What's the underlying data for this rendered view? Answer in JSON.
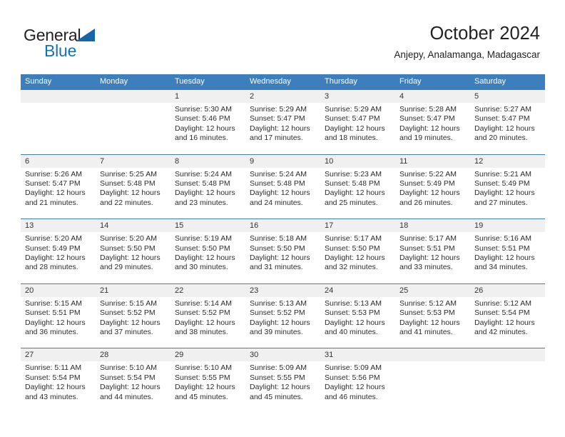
{
  "brand": {
    "name_part1": "General",
    "name_part2": "Blue",
    "triangle_icon": "triangle-icon",
    "color_dark": "#231f20",
    "color_blue": "#1570bc"
  },
  "header": {
    "title": "October 2024",
    "subtitle": "Anjepy, Analamanga, Madagascar"
  },
  "colors": {
    "header_blue": "#3d7ebd",
    "number_strip": "#f0f0f0",
    "text": "#2b2b2b"
  },
  "weekdays": [
    "Sunday",
    "Monday",
    "Tuesday",
    "Wednesday",
    "Thursday",
    "Friday",
    "Saturday"
  ],
  "weeks": [
    [
      {
        "day": "",
        "sunrise": "",
        "sunset": "",
        "daylight1": "",
        "daylight2": ""
      },
      {
        "day": "",
        "sunrise": "",
        "sunset": "",
        "daylight1": "",
        "daylight2": ""
      },
      {
        "day": "1",
        "sunrise": "Sunrise: 5:30 AM",
        "sunset": "Sunset: 5:46 PM",
        "daylight1": "Daylight: 12 hours",
        "daylight2": "and 16 minutes."
      },
      {
        "day": "2",
        "sunrise": "Sunrise: 5:29 AM",
        "sunset": "Sunset: 5:47 PM",
        "daylight1": "Daylight: 12 hours",
        "daylight2": "and 17 minutes."
      },
      {
        "day": "3",
        "sunrise": "Sunrise: 5:29 AM",
        "sunset": "Sunset: 5:47 PM",
        "daylight1": "Daylight: 12 hours",
        "daylight2": "and 18 minutes."
      },
      {
        "day": "4",
        "sunrise": "Sunrise: 5:28 AM",
        "sunset": "Sunset: 5:47 PM",
        "daylight1": "Daylight: 12 hours",
        "daylight2": "and 19 minutes."
      },
      {
        "day": "5",
        "sunrise": "Sunrise: 5:27 AM",
        "sunset": "Sunset: 5:47 PM",
        "daylight1": "Daylight: 12 hours",
        "daylight2": "and 20 minutes."
      }
    ],
    [
      {
        "day": "6",
        "sunrise": "Sunrise: 5:26 AM",
        "sunset": "Sunset: 5:47 PM",
        "daylight1": "Daylight: 12 hours",
        "daylight2": "and 21 minutes."
      },
      {
        "day": "7",
        "sunrise": "Sunrise: 5:25 AM",
        "sunset": "Sunset: 5:48 PM",
        "daylight1": "Daylight: 12 hours",
        "daylight2": "and 22 minutes."
      },
      {
        "day": "8",
        "sunrise": "Sunrise: 5:24 AM",
        "sunset": "Sunset: 5:48 PM",
        "daylight1": "Daylight: 12 hours",
        "daylight2": "and 23 minutes."
      },
      {
        "day": "9",
        "sunrise": "Sunrise: 5:24 AM",
        "sunset": "Sunset: 5:48 PM",
        "daylight1": "Daylight: 12 hours",
        "daylight2": "and 24 minutes."
      },
      {
        "day": "10",
        "sunrise": "Sunrise: 5:23 AM",
        "sunset": "Sunset: 5:48 PM",
        "daylight1": "Daylight: 12 hours",
        "daylight2": "and 25 minutes."
      },
      {
        "day": "11",
        "sunrise": "Sunrise: 5:22 AM",
        "sunset": "Sunset: 5:49 PM",
        "daylight1": "Daylight: 12 hours",
        "daylight2": "and 26 minutes."
      },
      {
        "day": "12",
        "sunrise": "Sunrise: 5:21 AM",
        "sunset": "Sunset: 5:49 PM",
        "daylight1": "Daylight: 12 hours",
        "daylight2": "and 27 minutes."
      }
    ],
    [
      {
        "day": "13",
        "sunrise": "Sunrise: 5:20 AM",
        "sunset": "Sunset: 5:49 PM",
        "daylight1": "Daylight: 12 hours",
        "daylight2": "and 28 minutes."
      },
      {
        "day": "14",
        "sunrise": "Sunrise: 5:20 AM",
        "sunset": "Sunset: 5:50 PM",
        "daylight1": "Daylight: 12 hours",
        "daylight2": "and 29 minutes."
      },
      {
        "day": "15",
        "sunrise": "Sunrise: 5:19 AM",
        "sunset": "Sunset: 5:50 PM",
        "daylight1": "Daylight: 12 hours",
        "daylight2": "and 30 minutes."
      },
      {
        "day": "16",
        "sunrise": "Sunrise: 5:18 AM",
        "sunset": "Sunset: 5:50 PM",
        "daylight1": "Daylight: 12 hours",
        "daylight2": "and 31 minutes."
      },
      {
        "day": "17",
        "sunrise": "Sunrise: 5:17 AM",
        "sunset": "Sunset: 5:50 PM",
        "daylight1": "Daylight: 12 hours",
        "daylight2": "and 32 minutes."
      },
      {
        "day": "18",
        "sunrise": "Sunrise: 5:17 AM",
        "sunset": "Sunset: 5:51 PM",
        "daylight1": "Daylight: 12 hours",
        "daylight2": "and 33 minutes."
      },
      {
        "day": "19",
        "sunrise": "Sunrise: 5:16 AM",
        "sunset": "Sunset: 5:51 PM",
        "daylight1": "Daylight: 12 hours",
        "daylight2": "and 34 minutes."
      }
    ],
    [
      {
        "day": "20",
        "sunrise": "Sunrise: 5:15 AM",
        "sunset": "Sunset: 5:51 PM",
        "daylight1": "Daylight: 12 hours",
        "daylight2": "and 36 minutes."
      },
      {
        "day": "21",
        "sunrise": "Sunrise: 5:15 AM",
        "sunset": "Sunset: 5:52 PM",
        "daylight1": "Daylight: 12 hours",
        "daylight2": "and 37 minutes."
      },
      {
        "day": "22",
        "sunrise": "Sunrise: 5:14 AM",
        "sunset": "Sunset: 5:52 PM",
        "daylight1": "Daylight: 12 hours",
        "daylight2": "and 38 minutes."
      },
      {
        "day": "23",
        "sunrise": "Sunrise: 5:13 AM",
        "sunset": "Sunset: 5:52 PM",
        "daylight1": "Daylight: 12 hours",
        "daylight2": "and 39 minutes."
      },
      {
        "day": "24",
        "sunrise": "Sunrise: 5:13 AM",
        "sunset": "Sunset: 5:53 PM",
        "daylight1": "Daylight: 12 hours",
        "daylight2": "and 40 minutes."
      },
      {
        "day": "25",
        "sunrise": "Sunrise: 5:12 AM",
        "sunset": "Sunset: 5:53 PM",
        "daylight1": "Daylight: 12 hours",
        "daylight2": "and 41 minutes."
      },
      {
        "day": "26",
        "sunrise": "Sunrise: 5:12 AM",
        "sunset": "Sunset: 5:54 PM",
        "daylight1": "Daylight: 12 hours",
        "daylight2": "and 42 minutes."
      }
    ],
    [
      {
        "day": "27",
        "sunrise": "Sunrise: 5:11 AM",
        "sunset": "Sunset: 5:54 PM",
        "daylight1": "Daylight: 12 hours",
        "daylight2": "and 43 minutes."
      },
      {
        "day": "28",
        "sunrise": "Sunrise: 5:10 AM",
        "sunset": "Sunset: 5:54 PM",
        "daylight1": "Daylight: 12 hours",
        "daylight2": "and 44 minutes."
      },
      {
        "day": "29",
        "sunrise": "Sunrise: 5:10 AM",
        "sunset": "Sunset: 5:55 PM",
        "daylight1": "Daylight: 12 hours",
        "daylight2": "and 45 minutes."
      },
      {
        "day": "30",
        "sunrise": "Sunrise: 5:09 AM",
        "sunset": "Sunset: 5:55 PM",
        "daylight1": "Daylight: 12 hours",
        "daylight2": "and 45 minutes."
      },
      {
        "day": "31",
        "sunrise": "Sunrise: 5:09 AM",
        "sunset": "Sunset: 5:56 PM",
        "daylight1": "Daylight: 12 hours",
        "daylight2": "and 46 minutes."
      },
      {
        "day": "",
        "sunrise": "",
        "sunset": "",
        "daylight1": "",
        "daylight2": ""
      },
      {
        "day": "",
        "sunrise": "",
        "sunset": "",
        "daylight1": "",
        "daylight2": ""
      }
    ]
  ]
}
